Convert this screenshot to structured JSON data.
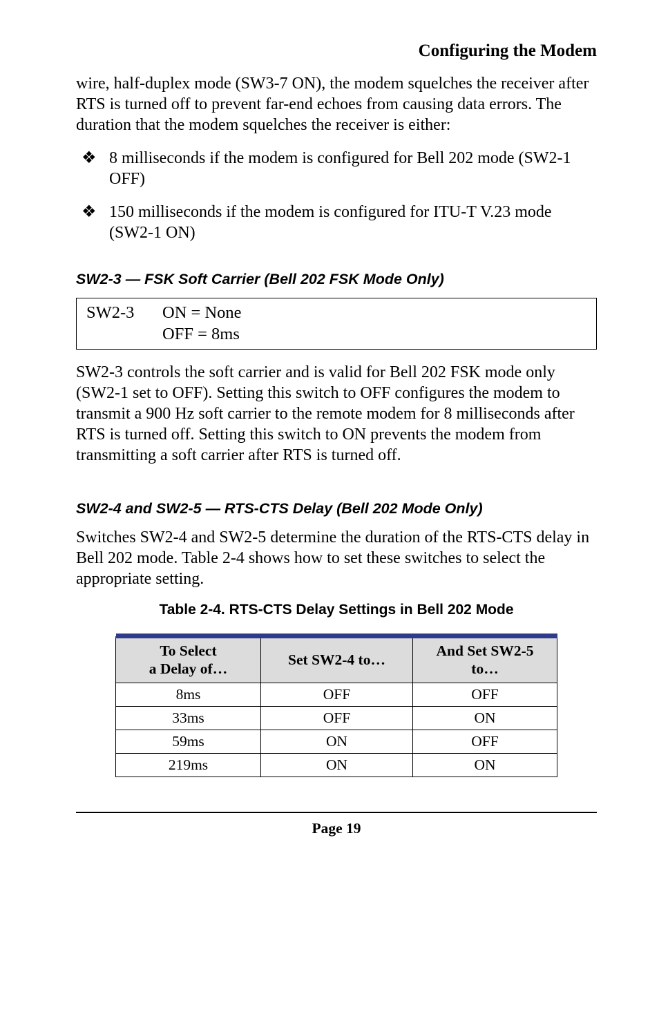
{
  "header": {
    "title": "Configuring the Modem"
  },
  "intro": "wire, half-duplex mode (SW3-7 ON), the modem squelches the receiver after RTS is turned off to prevent far-end echoes from causing data errors. The duration that the modem squelches the receiver is either:",
  "bullets": [
    "8 milliseconds if the modem is configured for Bell 202 mode (SW2-1 OFF)",
    "150 milliseconds if the modem is configured for ITU-T V.23 mode (SW2-1 ON)"
  ],
  "section1": {
    "prefix": "SW2-3",
    "emdash": " — ",
    "title": "FSK Soft Carrier (Bell 202 FSK Mode Only)",
    "box": {
      "label": "SW2-3",
      "line1": "ON = None",
      "line2": "OFF = 8ms"
    },
    "para": "SW2-3 controls the soft carrier and is valid for Bell 202 FSK mode only (SW2-1 set to OFF). Setting this switch to OFF configures the modem to transmit a 900 Hz soft carrier to the remote modem for 8 milliseconds after RTS is turned off. Setting this switch to ON prevents the modem from transmitting a soft carrier after RTS is turned off."
  },
  "section2": {
    "prefix": "SW2-4 and SW2-5",
    "emdash": " — ",
    "title": "RTS-CTS Delay (Bell 202 Mode Only)",
    "para": "Switches SW2-4 and SW2-5 determine the duration of the RTS-CTS delay in Bell 202 mode. Table 2-4 shows how to set these switches to select the appropriate setting.",
    "table_caption": "Table 2-4. RTS-CTS Delay Settings in Bell 202 Mode",
    "table": {
      "head": [
        "To Select a Delay of…",
        "Set SW2-4 to…",
        "And Set SW2-5 to…"
      ],
      "rows": [
        [
          "8ms",
          "OFF",
          "OFF"
        ],
        [
          "33ms",
          "OFF",
          "ON"
        ],
        [
          "59ms",
          "ON",
          "OFF"
        ],
        [
          "219ms",
          "ON",
          "ON"
        ]
      ]
    }
  },
  "footer": {
    "page": "Page 19"
  }
}
